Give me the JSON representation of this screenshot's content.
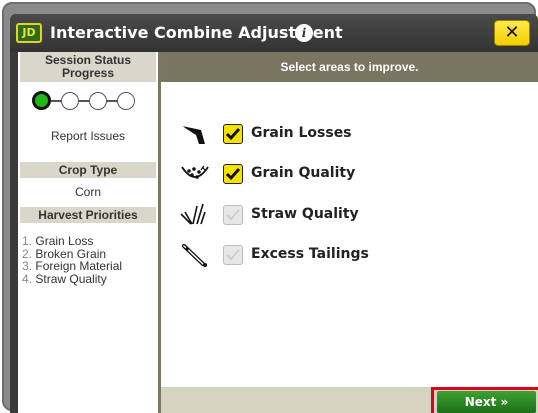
{
  "window": {
    "logo_text": "JD",
    "title": "Interactive Combine Adjustment",
    "info_icon": "i",
    "close_label": "✕"
  },
  "sidebar": {
    "session_status": "Session Status",
    "progress": "Progress",
    "progress_steps_total": 4,
    "progress_steps_complete": 1,
    "report_issues": "Report Issues",
    "crop_type_header": "Crop Type",
    "crop_type_value": "Corn",
    "harvest_priorities_header": "Harvest Priorities",
    "priorities": [
      {
        "num": "1.",
        "label": "Grain Loss"
      },
      {
        "num": "2.",
        "label": "Broken Grain"
      },
      {
        "num": "3.",
        "label": "Foreign Material"
      },
      {
        "num": "4.",
        "label": "Straw Quality"
      }
    ]
  },
  "main": {
    "header": "Select areas to improve.",
    "options": [
      {
        "label": "Grain Losses",
        "checked": true,
        "icon": "grain-losses-icon"
      },
      {
        "label": "Grain Quality",
        "checked": true,
        "icon": "grain-quality-icon"
      },
      {
        "label": "Straw Quality",
        "checked": false,
        "icon": "straw-quality-icon"
      },
      {
        "label": "Excess Tailings",
        "checked": false,
        "icon": "excess-tailings-icon"
      }
    ],
    "next_label": "Next »"
  },
  "colors": {
    "titlebar": "#3a3a3a",
    "accent_yellow": "#f5e100",
    "header_olive": "#7a7561",
    "side_header": "#d8d7c9",
    "next_green": "#2e8b22",
    "highlight_red": "#e0001b"
  }
}
